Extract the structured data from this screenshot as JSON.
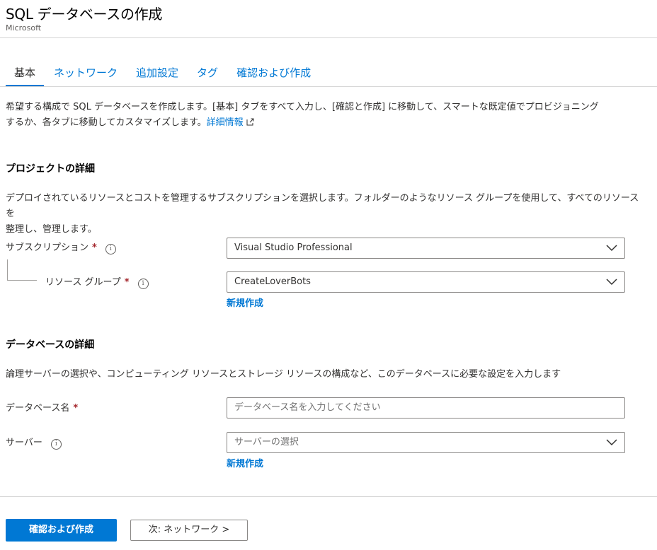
{
  "header": {
    "title": "SQL データベースの作成",
    "subtitle": "Microsoft"
  },
  "tabs": [
    {
      "label": "基本",
      "active": true
    },
    {
      "label": "ネットワーク",
      "active": false
    },
    {
      "label": "追加設定",
      "active": false
    },
    {
      "label": "タグ",
      "active": false
    },
    {
      "label": "確認および作成",
      "active": false
    }
  ],
  "intro": {
    "line1": "希望する構成で SQL データベースを作成します。[基本] タブをすべて入力し、[確認と作成] に移動して、スマートな既定値でプロビジョニング",
    "line2": "するか、各タブに移動してカスタマイズします。",
    "learn_more": "詳細情報"
  },
  "project": {
    "heading": "プロジェクトの詳細",
    "desc_line1": "デプロイされているリソースとコストを管理するサブスクリプションを選択します。フォルダーのようなリソース グループを使用して、すべてのリソースを",
    "desc_line2": "整理し、管理します。",
    "subscription_label": "サブスクリプション",
    "subscription_value": "Visual Studio Professional",
    "resource_group_label": "リソース グループ",
    "resource_group_value": "CreateLoverBots",
    "new_link": "新規作成"
  },
  "database": {
    "heading": "データベースの詳細",
    "desc": "論理サーバーの選択や、コンピューティング リソースとストレージ リソースの構成など、このデータベースに必要な設定を入力します",
    "name_label": "データベース名",
    "name_value": "",
    "name_placeholder": "データベース名を入力してください",
    "server_label": "サーバー",
    "server_placeholder": "サーバーの選択",
    "new_link": "新規作成"
  },
  "required_mark": "*",
  "info_glyph": "i",
  "footer": {
    "primary_button": "確認および作成",
    "next_button": "次: ネットワーク >"
  },
  "colors": {
    "accent": "#0078d4",
    "required": "#a4262c",
    "border": "#8a8886"
  },
  "icons": [
    "external-link-icon",
    "info-icon",
    "chevron-down-icon"
  ]
}
